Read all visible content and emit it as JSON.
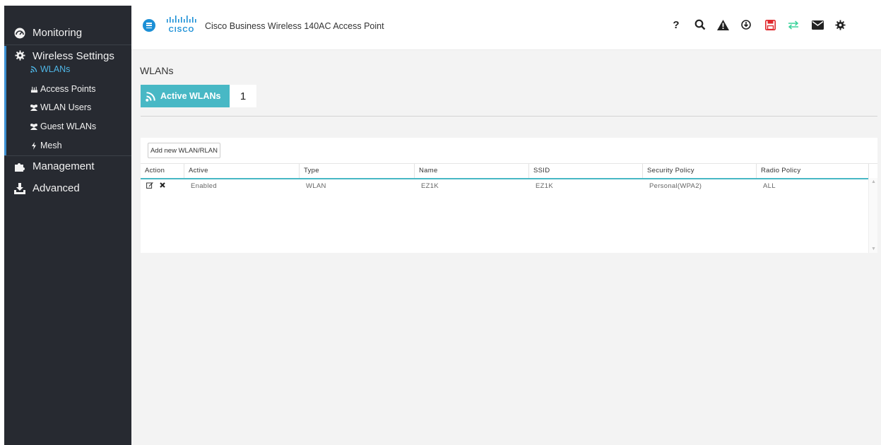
{
  "app": {
    "title": "Cisco Business Wireless 140AC Access Point",
    "logo_text": "CISCO"
  },
  "sidebar": {
    "monitoring": "Monitoring",
    "wireless_settings": "Wireless Settings",
    "sub_items": [
      {
        "label": "WLANs",
        "icon": "wifi-icon",
        "active": true
      },
      {
        "label": "Access Points",
        "icon": "access-point-icon"
      },
      {
        "label": "WLAN Users",
        "icon": "users-icon"
      },
      {
        "label": "Guest WLANs",
        "icon": "users-icon"
      },
      {
        "label": "Mesh",
        "icon": "bolt-icon"
      }
    ],
    "management": "Management",
    "advanced": "Advanced"
  },
  "header_icons": [
    "help-icon",
    "search-icon",
    "alert-icon",
    "download-icon",
    "save-icon",
    "transfer-icon",
    "mail-icon",
    "gear-icon"
  ],
  "main": {
    "page_title": "WLANs",
    "active_wlans_label": "Active WLANs",
    "active_wlans_count": "1",
    "add_button": "Add new WLAN/RLAN",
    "columns": [
      "Action",
      "Active",
      "Type",
      "Name",
      "SSID",
      "Security Policy",
      "Radio Policy"
    ],
    "rows": [
      {
        "active": "Enabled",
        "type": "WLAN",
        "name": "EZ1K",
        "ssid": "EZ1K",
        "security_policy": "Personal(WPA2)",
        "radio_policy": "ALL"
      }
    ]
  },
  "colors": {
    "sidebar_bg": "#272a31",
    "accent_teal": "#48b8c5",
    "active_link": "#4fb6e6",
    "brand_blue": "#1b8fd6",
    "save_red": "#e0282d",
    "transfer_green": "#3bd39b"
  }
}
